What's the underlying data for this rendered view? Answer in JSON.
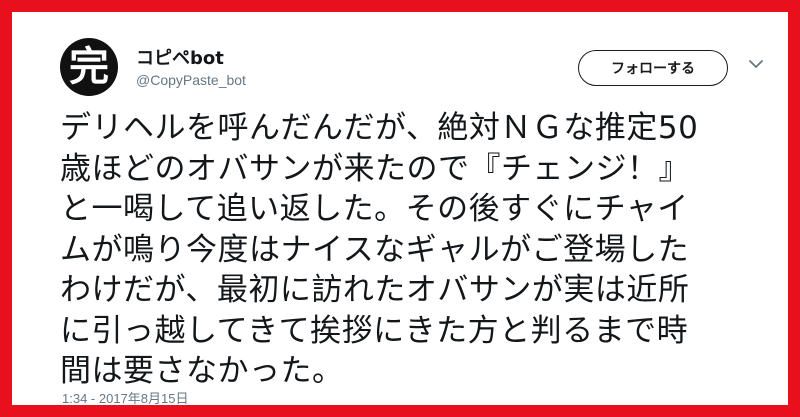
{
  "tweet": {
    "avatar_char": "完",
    "display_name": "コピペbot",
    "handle": "@CopyPaste_bot",
    "follow_label": "フォローする",
    "caret_icon": "chevron-down-icon",
    "text_lines": [
      "デリヘルを呼んだんだが、絶対ＮＧな推定50",
      "歳ほどのオバサンが来たので『チェンジ！』",
      "と一喝して追い返した。その後すぐにチャイ",
      "ムが鳴り今度はナイスなギャルがご登場した",
      "わけだが、最初に訪れたオバサンが実は近所",
      "に引っ越してきて挨拶にきた方と判るまで時",
      "間は要さなかった。"
    ],
    "timestamp": "1:34 - 2017年8月15日"
  },
  "colors": {
    "frame": "#e8101c",
    "text": "#14171a",
    "secondary": "#657786"
  }
}
